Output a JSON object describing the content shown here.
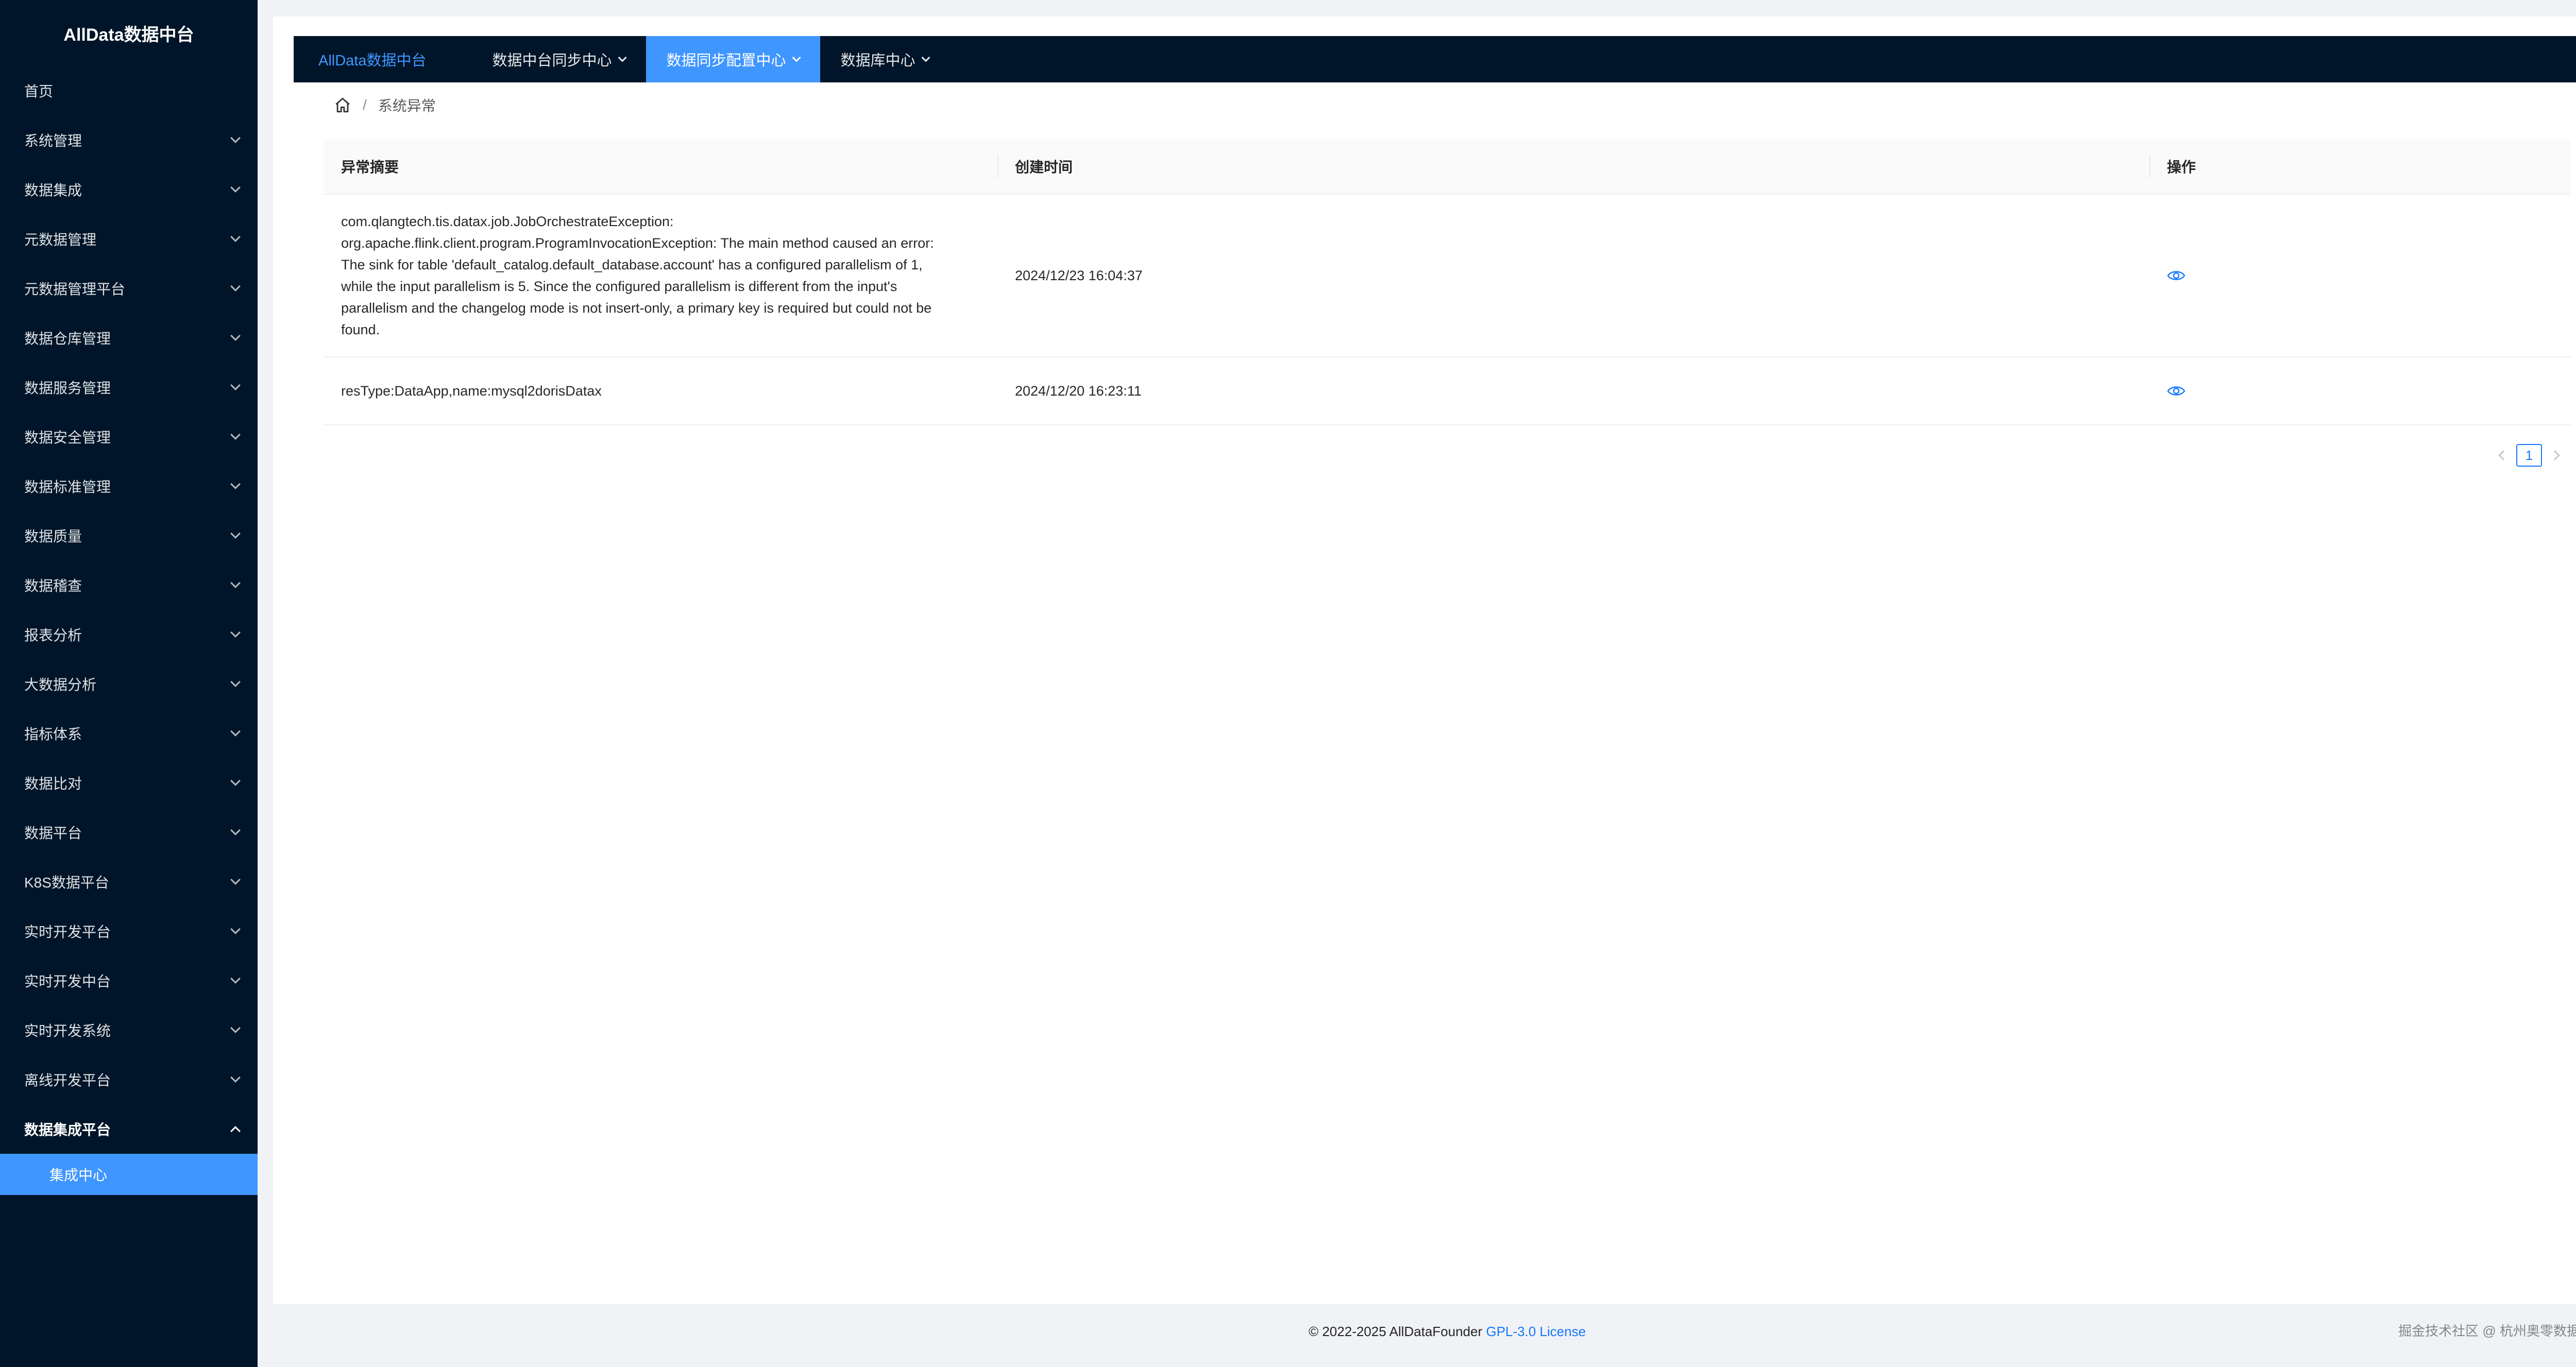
{
  "app": {
    "title": "AllData数据中台"
  },
  "sidebar": {
    "items": [
      {
        "label": "首页",
        "has_arrow": false
      },
      {
        "label": "系统管理",
        "has_arrow": true
      },
      {
        "label": "数据集成",
        "has_arrow": true
      },
      {
        "label": "元数据管理",
        "has_arrow": true
      },
      {
        "label": "元数据管理平台",
        "has_arrow": true
      },
      {
        "label": "数据仓库管理",
        "has_arrow": true
      },
      {
        "label": "数据服务管理",
        "has_arrow": true
      },
      {
        "label": "数据安全管理",
        "has_arrow": true
      },
      {
        "label": "数据标准管理",
        "has_arrow": true
      },
      {
        "label": "数据质量",
        "has_arrow": true
      },
      {
        "label": "数据稽查",
        "has_arrow": true
      },
      {
        "label": "报表分析",
        "has_arrow": true
      },
      {
        "label": "大数据分析",
        "has_arrow": true
      },
      {
        "label": "指标体系",
        "has_arrow": true
      },
      {
        "label": "数据比对",
        "has_arrow": true
      },
      {
        "label": "数据平台",
        "has_arrow": true
      },
      {
        "label": "K8S数据平台",
        "has_arrow": true
      },
      {
        "label": "实时开发平台",
        "has_arrow": true
      },
      {
        "label": "实时开发中台",
        "has_arrow": true
      },
      {
        "label": "实时开发系统",
        "has_arrow": true
      },
      {
        "label": "离线开发平台",
        "has_arrow": true
      },
      {
        "label": "数据集成平台",
        "has_arrow": true,
        "open": true
      }
    ],
    "sub_item": "集成中心"
  },
  "topnav": {
    "brand": "AllData数据中台",
    "items": [
      "数据中台同步中心",
      "数据同步配置中心",
      "数据库中心"
    ],
    "active_index": 1
  },
  "breadcrumb": {
    "current": "系统异常"
  },
  "table": {
    "headers": [
      "异常摘要",
      "创建时间",
      "操作"
    ],
    "rows": [
      {
        "summary_lines": [
          "com.qlangtech.tis.datax.job.JobOrchestrateException:",
          "org.apache.flink.client.program.ProgramInvocationException: The main method caused an error:",
          "The sink for table 'default_catalog.default_database.account' has a configured parallelism of 1,",
          "while the input parallelism is 5. Since the configured parallelism is different from the input's",
          "parallelism and the changelog mode is not insert-only, a primary key is required but could not be",
          "found."
        ],
        "created": "2024/12/23 16:04:37",
        "action_icon": "eye-icon"
      },
      {
        "summary_lines": [
          "resType:DataApp,name:mysql2dorisDatax"
        ],
        "created": "2024/12/20 16:23:11",
        "action_icon": "eye-icon"
      }
    ]
  },
  "pagination": {
    "current": "1"
  },
  "footer": {
    "text": "© 2022-2025 AllDataFounder ",
    "link": "GPL-3.0 License"
  },
  "watermark": "掘金技术社区 @ 杭州奥零数据科技",
  "colors": {
    "sidebar_bg": "#001529",
    "accent": "#4096ff",
    "link": "#1677ff"
  }
}
